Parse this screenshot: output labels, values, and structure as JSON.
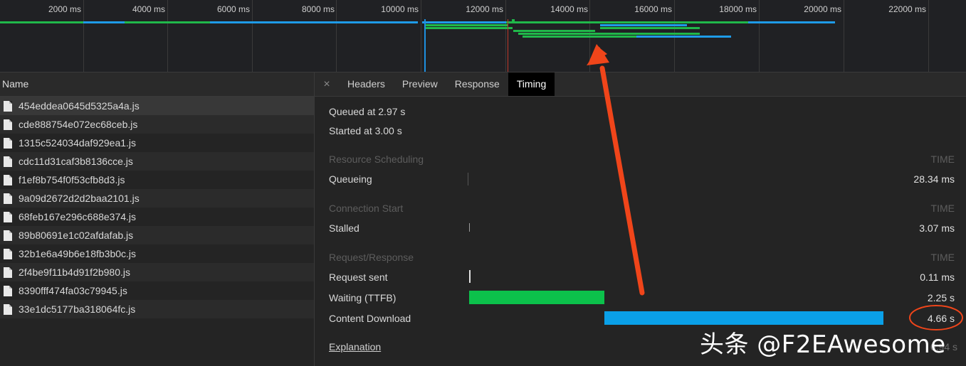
{
  "overview": {
    "tick_labels": [
      "2000 ms",
      "4000 ms",
      "6000 ms",
      "8000 ms",
      "10000 ms",
      "12000 ms",
      "14000 ms",
      "16000 ms",
      "18000 ms",
      "20000 ms",
      "22000 ms"
    ]
  },
  "list": {
    "header": "Name",
    "items": [
      "454eddea0645d5325a4a.js",
      "cde888754e072ec68ceb.js",
      "1315c524034daf929ea1.js",
      "cdc11d31caf3b8136cce.js",
      "f1ef8b754f0f53cfb8d3.js",
      "9a09d2672d2d2baa2101.js",
      "68feb167e296c688e374.js",
      "89b80691e1c02afdafab.js",
      "32b1e6a49b6e18fb3b0c.js",
      "2f4be9f11b4d91f2b980.js",
      "8390fff474fa03c79945.js",
      "33e1dc5177ba318064fc.js"
    ]
  },
  "tabs": {
    "close": "×",
    "items": [
      "Headers",
      "Preview",
      "Response",
      "Timing"
    ],
    "active": "Timing"
  },
  "timing": {
    "queued_at": "Queued at 2.97 s",
    "started_at": "Started at 3.00 s",
    "sections": {
      "scheduling": {
        "title": "Resource Scheduling",
        "time": "TIME"
      },
      "connection": {
        "title": "Connection Start",
        "time": "TIME"
      },
      "request": {
        "title": "Request/Response",
        "time": "TIME"
      }
    },
    "rows": {
      "queueing": {
        "label": "Queueing",
        "value": "28.34 ms"
      },
      "stalled": {
        "label": "Stalled",
        "value": "3.07 ms"
      },
      "request_sent": {
        "label": "Request sent",
        "value": "0.11 ms"
      },
      "waiting": {
        "label": "Waiting (TTFB)",
        "value": "2.25 s"
      },
      "download": {
        "label": "Content Download",
        "value": "4.66 s"
      }
    },
    "explanation": "Explanation",
    "total_faded": "6.94 s"
  },
  "watermark": "头条 @F2EAwesome",
  "colors": {
    "waiting_bar": "#0cc14b",
    "download_bar": "#0aa0e8",
    "annotation": "#f0451a"
  }
}
